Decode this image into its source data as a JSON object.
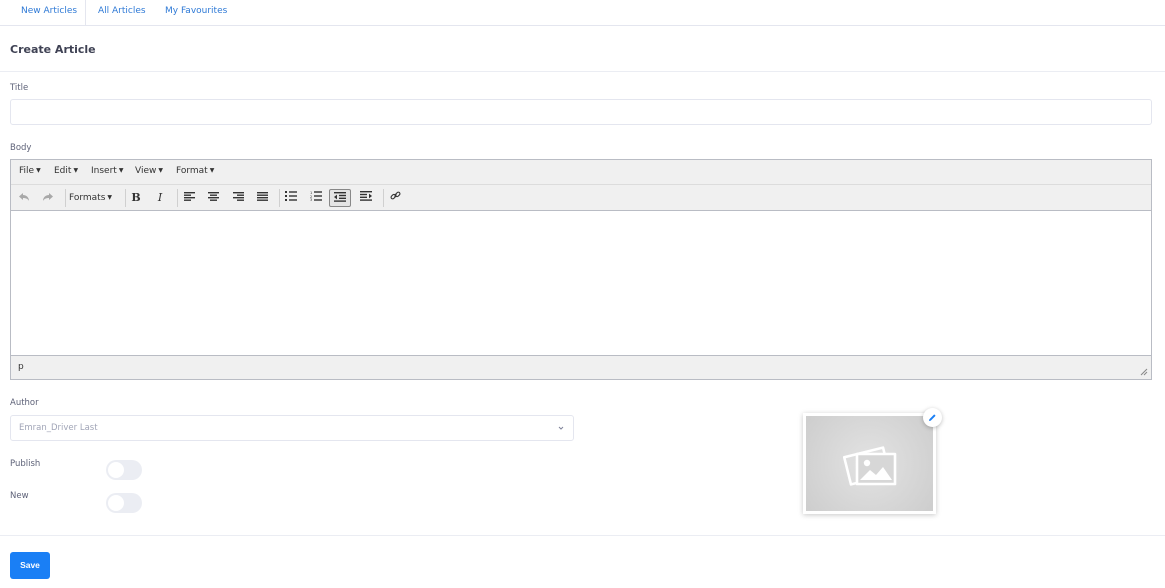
{
  "tabs": [
    {
      "label": "New Articles",
      "active": true
    },
    {
      "label": "All Articles",
      "active": false
    },
    {
      "label": "My Favourites",
      "active": false
    }
  ],
  "card": {
    "title": "Create Article"
  },
  "form": {
    "title_label": "Title",
    "title_value": "",
    "body_label": "Body",
    "author_label": "Author",
    "author_value": "Emran_Driver Last",
    "publish_label": "Publish",
    "publish_on": false,
    "new_label": "New",
    "new_on": false
  },
  "editor": {
    "menus": [
      "File",
      "Edit",
      "Insert",
      "View",
      "Format"
    ],
    "formats_label": "Formats",
    "toolbar_icons": [
      "undo-icon",
      "redo-icon",
      "bold-icon",
      "italic-icon",
      "align-left-icon",
      "align-center-icon",
      "align-right-icon",
      "align-justify-icon",
      "bullet-list-icon",
      "numbered-list-icon",
      "outdent-icon",
      "indent-icon",
      "link-icon"
    ],
    "status_path": "p"
  },
  "image": {
    "placeholder_icon": "image-placeholder-icon",
    "edit_icon": "pencil-icon"
  },
  "actions": {
    "save_label": "Save"
  },
  "colors": {
    "accent": "#1a7ff5",
    "link": "#2f7ad6",
    "border": "#e4e6ef"
  }
}
